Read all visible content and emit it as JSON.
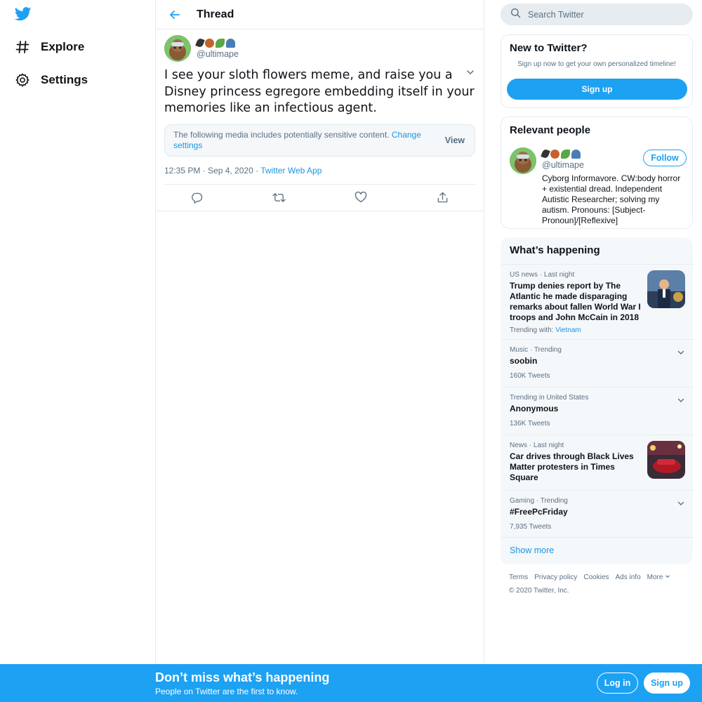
{
  "nav": {
    "items": [
      {
        "label": "Explore",
        "icon": "hashtag-icon"
      },
      {
        "label": "Settings",
        "icon": "gear-icon"
      }
    ]
  },
  "main": {
    "title": "Thread",
    "tweet": {
      "handle": "@ultimape",
      "text": "I see your sloth flowers meme, and raise you a Disney princess egregore embedding itself in your memories like an infectious agent.",
      "sensitive_message": "The following media includes potentially sensitive content.",
      "sensitive_link": "Change settings",
      "view_label": "View",
      "timestamp": "12:35 PM · Sep 4, 2020",
      "separator": "·",
      "source": "Twitter Web App"
    }
  },
  "search": {
    "placeholder": "Search Twitter"
  },
  "new_card": {
    "title": "New to Twitter?",
    "subtitle": "Sign up now to get your own personalized timeline!",
    "signup_label": "Sign up"
  },
  "relevant": {
    "title": "Relevant people",
    "handle": "@ultimape",
    "follow_label": "Follow",
    "bio": "Cyborg Informavore. CW:body horror + existential dread. Independent Autistic Researcher; solving my autism. Pronouns: [Subject-Pronoun]/[Reflexive]"
  },
  "happening": {
    "title": "What’s happening",
    "trends": [
      {
        "context": "US news · Last night",
        "title": "Trump denies report by The Atlantic he made disparaging remarks about fallen World War I troops and John McCain in 2018",
        "extra_prefix": "Trending with: ",
        "extra_link": "Vietnam"
      },
      {
        "context": "Music · Trending",
        "title": "soobin",
        "count": "160K Tweets"
      },
      {
        "context": "Trending in United States",
        "title": "Anonymous",
        "count": "136K Tweets"
      },
      {
        "context": "News · Last night",
        "title": "Car drives through Black Lives Matter protesters in Times Square"
      },
      {
        "context": "Gaming · Trending",
        "title": "#FreePcFriday",
        "count": "7,935 Tweets"
      }
    ],
    "show_more": "Show more"
  },
  "footer": {
    "links": [
      "Terms",
      "Privacy policy",
      "Cookies",
      "Ads info",
      "More"
    ],
    "copyright": "© 2020 Twitter, Inc."
  },
  "bottom_bar": {
    "title": "Don’t miss what’s happening",
    "subtitle": "People on Twitter are the first to know.",
    "login_label": "Log in",
    "signup_label": "Sign up"
  },
  "colors": {
    "accent": "#1da1f2",
    "link": "#1b95e0",
    "secondary_text": "#5b7083",
    "border": "#e6ecf0"
  }
}
